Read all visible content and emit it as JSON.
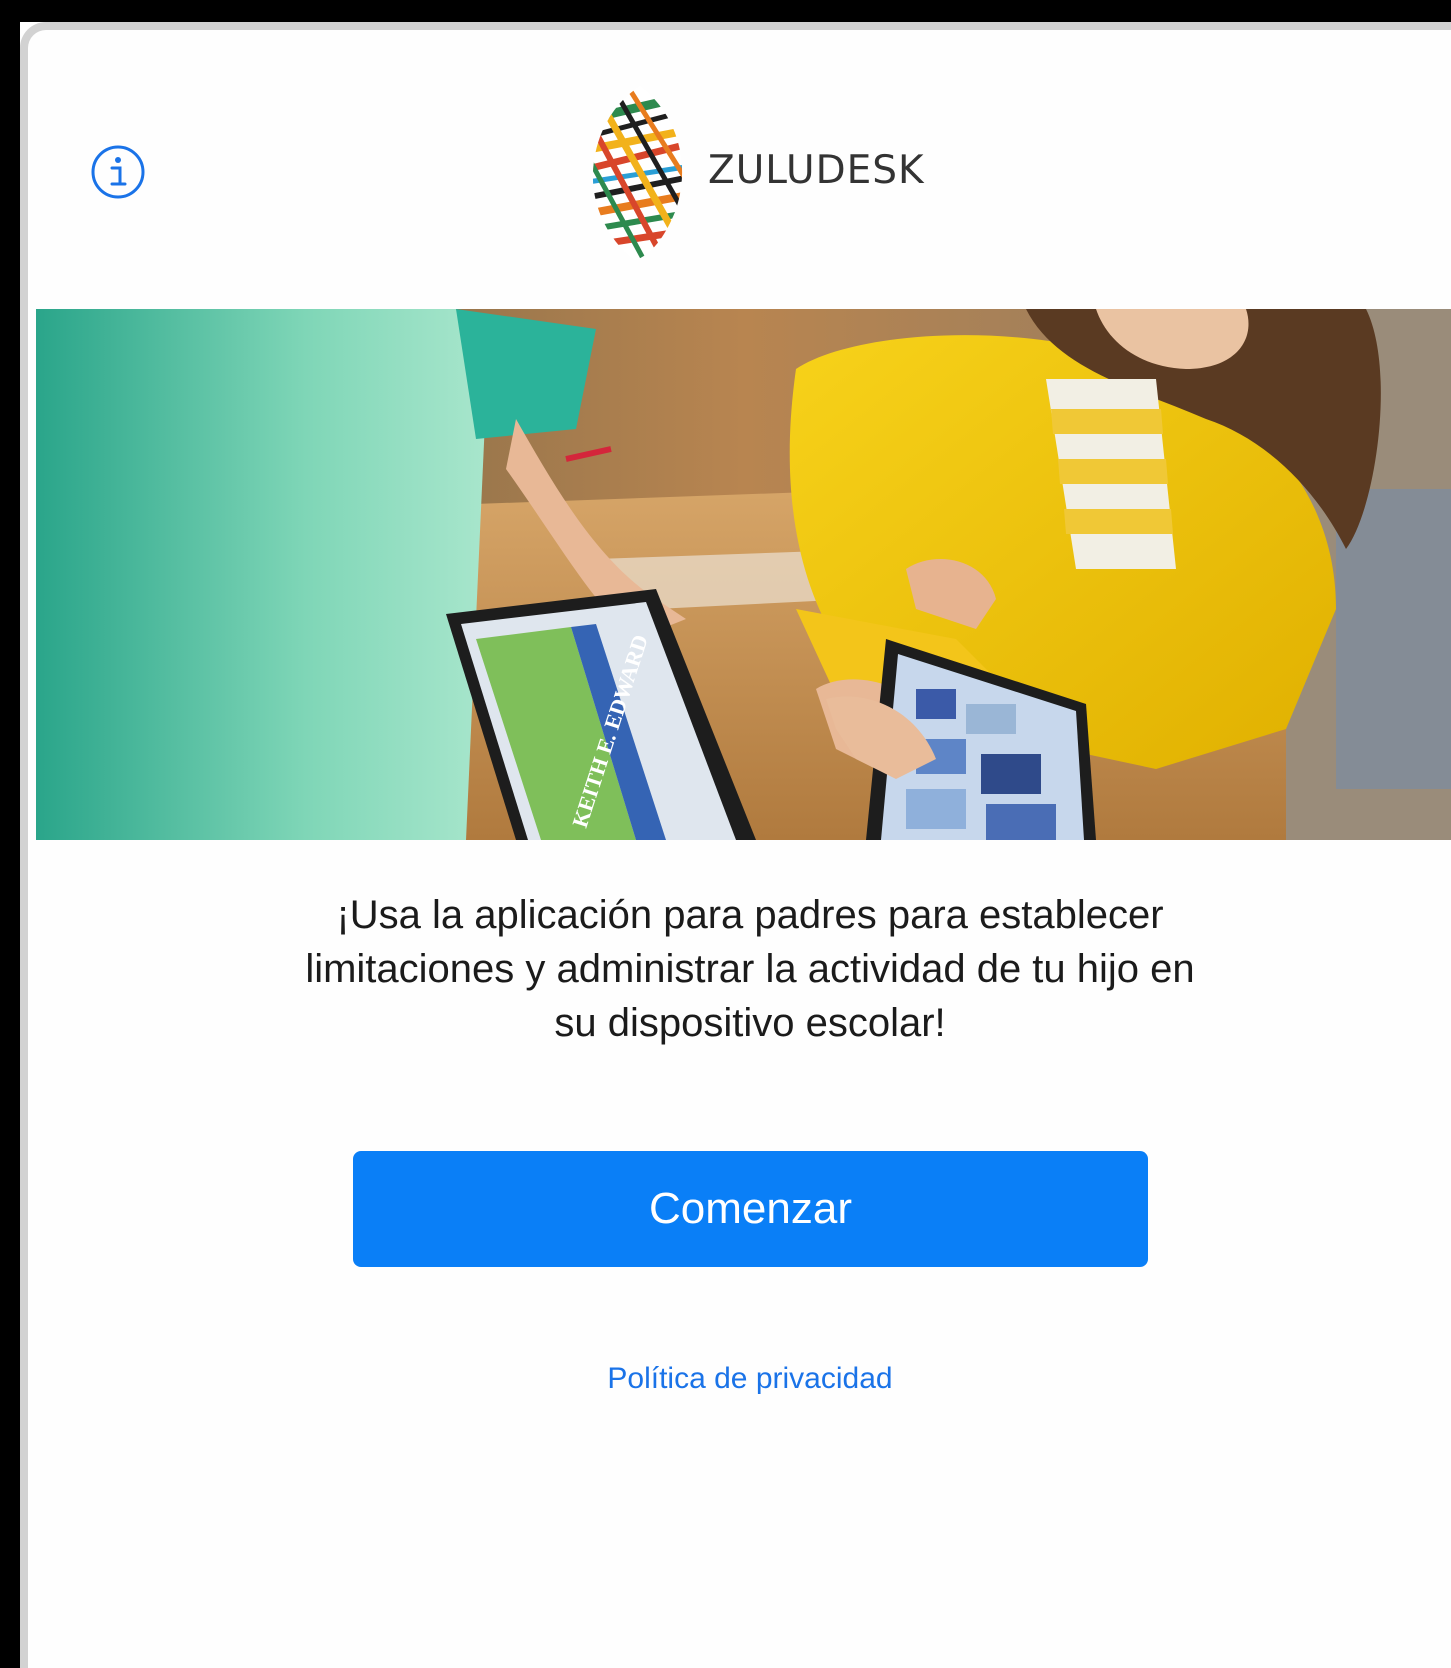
{
  "app": {
    "brand_name": "ZULUDESK"
  },
  "header": {
    "info_icon": "info-circle-icon"
  },
  "hero": {
    "image": "children-using-tablets-photo",
    "tablet_text": "KEITH E. EDWARD"
  },
  "main": {
    "message": "¡Usa la aplicación para padres para establecer limitaciones y administrar la actividad de tu hijo en su dispositivo escolar!",
    "start_button_label": "Comenzar",
    "privacy_link_label": "Política de privacidad"
  },
  "colors": {
    "accent": "#0a7ff7",
    "link": "#1a73e8",
    "text": "#1b1b1b",
    "background": "#ffffff"
  }
}
